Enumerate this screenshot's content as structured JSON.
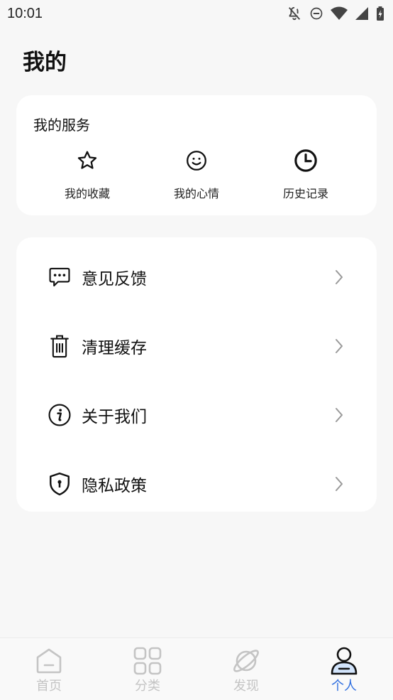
{
  "status_bar": {
    "time": "10:01"
  },
  "page": {
    "title": "我的"
  },
  "services": {
    "title": "我的服务",
    "items": [
      {
        "label": "我的收藏",
        "icon": "star-icon"
      },
      {
        "label": "我的心情",
        "icon": "smiley-icon"
      },
      {
        "label": "历史记录",
        "icon": "clock-icon"
      }
    ]
  },
  "menu": {
    "items": [
      {
        "label": "意见反馈",
        "icon": "feedback-chat-icon"
      },
      {
        "label": "清理缓存",
        "icon": "trash-icon"
      },
      {
        "label": "关于我们",
        "icon": "info-icon"
      },
      {
        "label": "隐私政策",
        "icon": "shield-icon"
      }
    ]
  },
  "tab_bar": {
    "tabs": [
      {
        "label": "首页",
        "icon": "home-icon",
        "active": false
      },
      {
        "label": "分类",
        "icon": "grid-icon",
        "active": false
      },
      {
        "label": "发现",
        "icon": "planet-icon",
        "active": false
      },
      {
        "label": "个人",
        "icon": "person-icon",
        "active": true
      }
    ]
  },
  "colors": {
    "accent": "#2f6fe0",
    "inactive": "#c4c4c4",
    "background": "#f7f7f7",
    "card": "#ffffff"
  }
}
